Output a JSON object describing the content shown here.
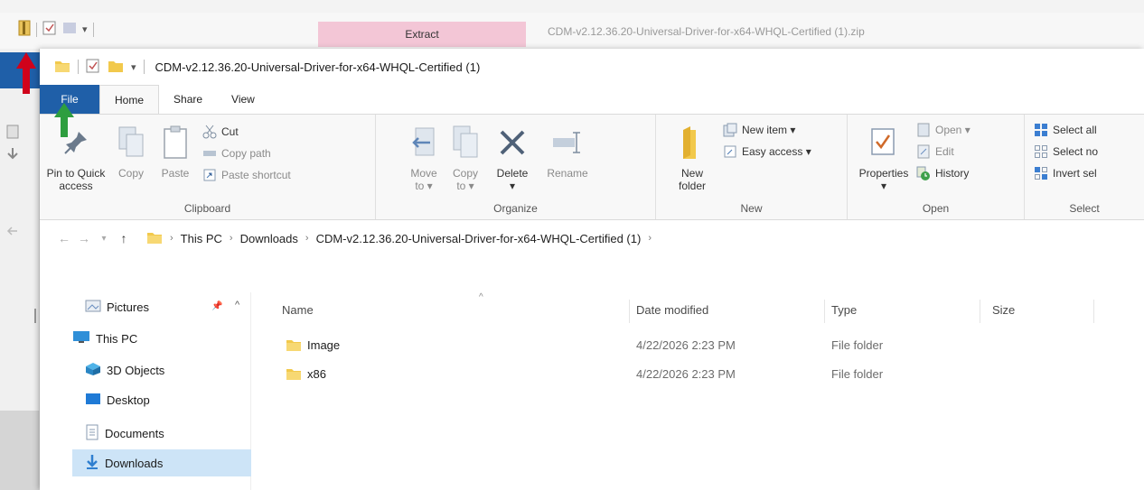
{
  "back_window": {
    "extract_tab": "Extract",
    "title": "CDM-v2.12.36.20-Universal-Driver-for-x64-WHQL-Certified (1).zip"
  },
  "window": {
    "title": "CDM-v2.12.36.20-Universal-Driver-for-x64-WHQL-Certified (1)"
  },
  "ribbon_tabs": [
    "File",
    "Home",
    "Share",
    "View"
  ],
  "ribbon": {
    "clipboard": {
      "label": "Clipboard",
      "pin": "Pin to Quick access",
      "pin_l1": "Pin to Quick",
      "pin_l2": "access",
      "copy": "Copy",
      "paste": "Paste",
      "cut": "Cut",
      "copy_path": "Copy path",
      "paste_shortcut": "Paste shortcut"
    },
    "organize": {
      "label": "Organize",
      "move_l1": "Move",
      "move_l2": "to ▾",
      "copy_l1": "Copy",
      "copy_l2": "to ▾",
      "delete": "Delete",
      "delete_drop": "▾",
      "rename": "Rename"
    },
    "new": {
      "label": "New",
      "new_folder_l1": "New",
      "new_folder_l2": "folder",
      "new_item": "New item ▾",
      "easy_access": "Easy access ▾"
    },
    "open": {
      "label": "Open",
      "properties": "Properties",
      "properties_drop": "▾",
      "open": "Open ▾",
      "edit": "Edit",
      "history": "History"
    },
    "select": {
      "label": "Select",
      "select_all": "Select all",
      "select_none": "Select no",
      "invert": "Invert sel"
    }
  },
  "address": {
    "crumbs": [
      "This PC",
      "Downloads",
      "CDM-v2.12.36.20-Universal-Driver-for-x64-WHQL-Certified (1)"
    ]
  },
  "nav": {
    "pictures": "Pictures",
    "this_pc": "This PC",
    "objects": "3D Objects",
    "desktop": "Desktop",
    "documents": "Documents",
    "downloads": "Downloads"
  },
  "columns": {
    "name": "Name",
    "date": "Date modified",
    "type": "Type",
    "size": "Size"
  },
  "files": [
    {
      "name": "Image",
      "date": "4/22/2026 2:23 PM",
      "type": "File folder"
    },
    {
      "name": "x86",
      "date": "4/22/2026 2:23 PM",
      "type": "File folder"
    }
  ],
  "colors": {
    "file_tab": "#1f5fa8",
    "folder": "#f2c94c",
    "arrow_red": "#d0021b",
    "arrow_green": "#2e9e3f",
    "extract_tab": "#f3c6d6",
    "selected": "#cde4f7"
  },
  "icons": [
    "folder-icon",
    "pin-icon",
    "copy-icon",
    "paste-icon",
    "cut-icon",
    "copy-path-icon",
    "paste-shortcut-icon",
    "move-to-icon",
    "copy-to-icon",
    "delete-icon",
    "rename-icon",
    "new-folder-icon",
    "new-item-icon",
    "easy-access-icon",
    "properties-icon",
    "open-icon",
    "edit-icon",
    "history-icon",
    "select-all-icon",
    "select-none-icon",
    "invert-selection-icon",
    "pictures-icon",
    "this-pc-icon",
    "3d-objects-icon",
    "desktop-icon",
    "documents-icon",
    "downloads-icon",
    "back-arrow-icon",
    "forward-arrow-icon",
    "up-arrow-icon",
    "red-arrow",
    "green-arrow"
  ]
}
